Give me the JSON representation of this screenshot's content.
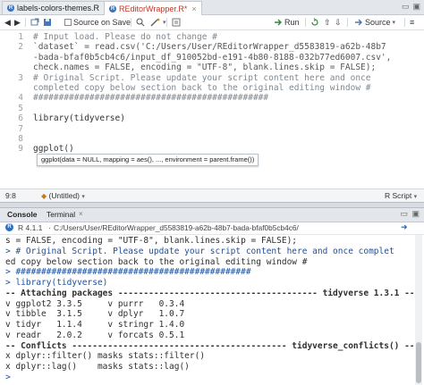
{
  "editor": {
    "tabs": [
      {
        "label": "labels-colors-themes.R"
      },
      {
        "label": "REditorWrapper.R*"
      }
    ],
    "toolbar": {
      "source_on_save": "Source on Save",
      "run": "Run",
      "source": "Source"
    },
    "lines": [
      {
        "n": "1",
        "text": "# Input load. Please do not change #"
      },
      {
        "n": "2",
        "text": "`dataset` = read.csv('C:/Users/User/REditorWrapper_d5583819-a62b-48b7"
      },
      {
        "n": "",
        "text": "-bada-bfaf0b5cb4c6/input_df_910052bd-e191-4b80-8188-032b77ed6007.csv',"
      },
      {
        "n": "",
        "text": "check.names = FALSE, encoding = \"UTF-8\", blank.lines.skip = FALSE);"
      },
      {
        "n": "3",
        "text": "# Original Script. Please update your script content here and once"
      },
      {
        "n": "",
        "text": "completed copy below section back to the original editing window #"
      },
      {
        "n": "4",
        "text": "##############################################"
      },
      {
        "n": "5",
        "text": ""
      },
      {
        "n": "6",
        "text": "library(tidyverse)"
      },
      {
        "n": "7",
        "text": ""
      },
      {
        "n": "8",
        "text": ""
      },
      {
        "n": "9",
        "text": "ggplot()"
      }
    ],
    "autocomplete": "ggplot(data = NULL, mapping = aes(), ..., environment = parent.frame())",
    "status": {
      "position": "9:8",
      "scope": "(Untitled)",
      "filetype": "R Script"
    }
  },
  "console": {
    "tabs": [
      "Console",
      "Terminal"
    ],
    "version": "R 4.1.1",
    "path": "C:/Users/User/REditorWrapper_d5583819-a62b-48b7-bada-bfaf0b5cb4c6/",
    "lines": [
      "s = FALSE, encoding = \"UTF-8\", blank.lines.skip = FALSE);",
      "> # Original Script. Please update your script content here and once complet",
      "ed copy below section back to the original editing window #",
      "> ##############################################",
      "> library(tidyverse)",
      "-- Attaching packages --------------------------------------- tidyverse 1.3.1 --",
      "v ggplot2 3.3.5     v purrr   0.3.4",
      "v tibble  3.1.5     v dplyr   1.0.7",
      "v tidyr   1.1.4     v stringr 1.4.0",
      "v readr   2.0.2     v forcats 0.5.1",
      "-- Conflicts ------------------------------------------ tidyverse_conflicts() --",
      "x dplyr::filter() masks stats::filter()",
      "x dplyr::lag()    masks stats::lag()",
      ">"
    ]
  }
}
